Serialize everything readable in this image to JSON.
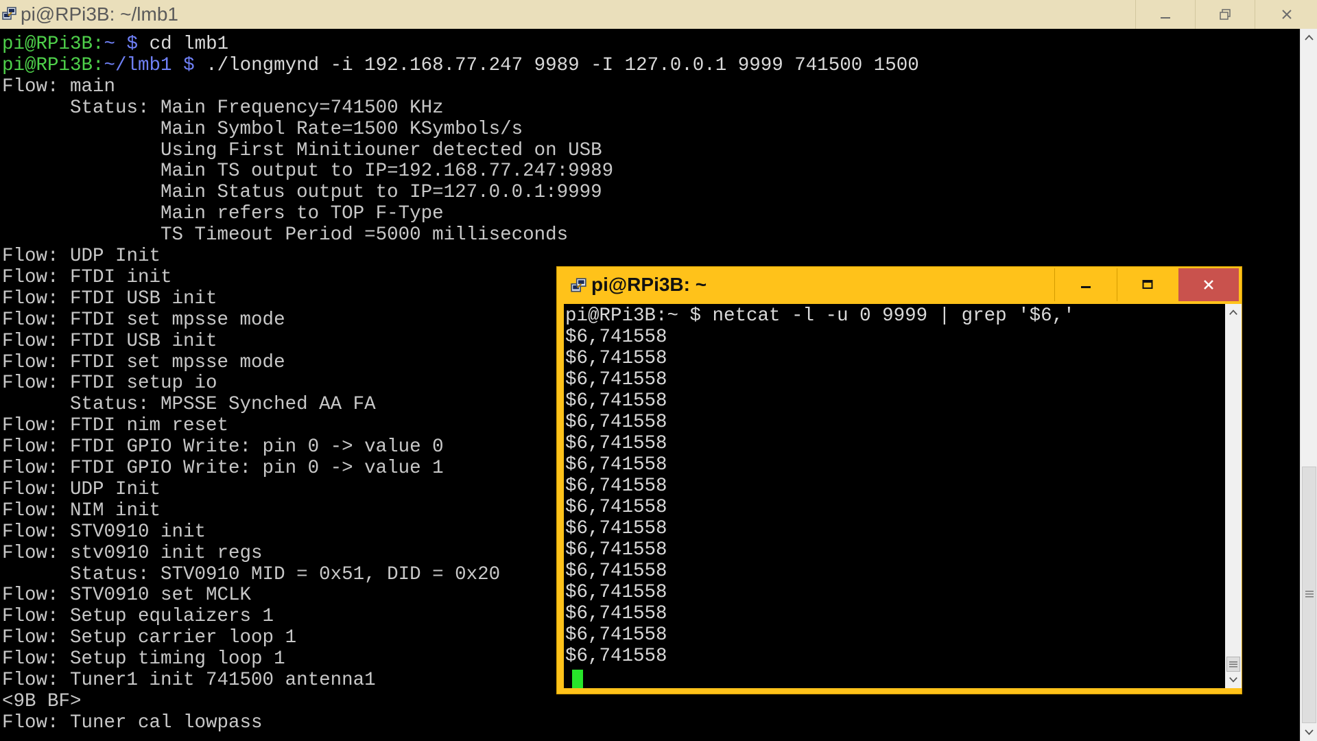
{
  "main_window": {
    "title": "pi@RPi3B: ~/lmb1",
    "lines": [
      [
        {
          "t": "pi@RPi3B:",
          "c": "green"
        },
        {
          "t": "~ ",
          "c": "blue"
        },
        {
          "t": "$ ",
          "c": "blue"
        },
        {
          "t": "cd lmb1",
          "c": "white"
        }
      ],
      [
        {
          "t": "pi@RPi3B:",
          "c": "green"
        },
        {
          "t": "~/lmb1 ",
          "c": "blue"
        },
        {
          "t": "$ ",
          "c": "blue"
        },
        {
          "t": "./longmynd -i 192.168.77.247 9989 -I 127.0.0.1 9999 741500 1500",
          "c": "white"
        }
      ],
      [
        {
          "t": "Flow: main",
          "c": "plain"
        }
      ],
      [
        {
          "t": "      Status: Main Frequency=741500 KHz",
          "c": "plain"
        }
      ],
      [
        {
          "t": "              Main Symbol Rate=1500 KSymbols/s",
          "c": "plain"
        }
      ],
      [
        {
          "t": "              Using First Minitiouner detected on USB",
          "c": "plain"
        }
      ],
      [
        {
          "t": "              Main TS output to IP=192.168.77.247:9989",
          "c": "plain"
        }
      ],
      [
        {
          "t": "              Main Status output to IP=127.0.0.1:9999",
          "c": "plain"
        }
      ],
      [
        {
          "t": "              Main refers to TOP F-Type",
          "c": "plain"
        }
      ],
      [
        {
          "t": "              TS Timeout Period =5000 milliseconds",
          "c": "plain"
        }
      ],
      [
        {
          "t": "Flow: UDP Init",
          "c": "plain"
        }
      ],
      [
        {
          "t": "Flow: FTDI init",
          "c": "plain"
        }
      ],
      [
        {
          "t": "Flow: FTDI USB init",
          "c": "plain"
        }
      ],
      [
        {
          "t": "Flow: FTDI set mpsse mode",
          "c": "plain"
        }
      ],
      [
        {
          "t": "Flow: FTDI USB init",
          "c": "plain"
        }
      ],
      [
        {
          "t": "Flow: FTDI set mpsse mode",
          "c": "plain"
        }
      ],
      [
        {
          "t": "Flow: FTDI setup io",
          "c": "plain"
        }
      ],
      [
        {
          "t": "      Status: MPSSE Synched AA FA",
          "c": "plain"
        }
      ],
      [
        {
          "t": "Flow: FTDI nim reset",
          "c": "plain"
        }
      ],
      [
        {
          "t": "Flow: FTDI GPIO Write: pin 0 -> value 0",
          "c": "plain"
        }
      ],
      [
        {
          "t": "Flow: FTDI GPIO Write: pin 0 -> value 1",
          "c": "plain"
        }
      ],
      [
        {
          "t": "Flow: UDP Init",
          "c": "plain"
        }
      ],
      [
        {
          "t": "Flow: NIM init",
          "c": "plain"
        }
      ],
      [
        {
          "t": "Flow: STV0910 init",
          "c": "plain"
        }
      ],
      [
        {
          "t": "Flow: stv0910 init regs",
          "c": "plain"
        }
      ],
      [
        {
          "t": "      Status: STV0910 MID = 0x51, DID = 0x20",
          "c": "plain"
        }
      ],
      [
        {
          "t": "Flow: STV0910 set MCLK",
          "c": "plain"
        }
      ],
      [
        {
          "t": "Flow: Setup equlaizers 1",
          "c": "plain"
        }
      ],
      [
        {
          "t": "Flow: Setup carrier loop 1",
          "c": "plain"
        }
      ],
      [
        {
          "t": "Flow: Setup timing loop 1",
          "c": "plain"
        }
      ],
      [
        {
          "t": "Flow: Tuner1 init 741500 antenna1",
          "c": "plain"
        }
      ],
      [
        {
          "t": "<9B BF>",
          "c": "plain"
        }
      ],
      [
        {
          "t": "Flow: Tuner cal lowpass",
          "c": "plain"
        }
      ]
    ]
  },
  "popup_window": {
    "title": "pi@RPi3B: ~",
    "lines": [
      [
        {
          "t": "pi@RPi3B:~ $ netcat -l -u 0 9999 | grep '$6,'",
          "c": "white"
        }
      ],
      [
        {
          "t": "$6,741558",
          "c": "white"
        }
      ],
      [
        {
          "t": "$6,741558",
          "c": "white"
        }
      ],
      [
        {
          "t": "$6,741558",
          "c": "white"
        }
      ],
      [
        {
          "t": "$6,741558",
          "c": "white"
        }
      ],
      [
        {
          "t": "$6,741558",
          "c": "white"
        }
      ],
      [
        {
          "t": "$6,741558",
          "c": "white"
        }
      ],
      [
        {
          "t": "$6,741558",
          "c": "white"
        }
      ],
      [
        {
          "t": "$6,741558",
          "c": "white"
        }
      ],
      [
        {
          "t": "$6,741558",
          "c": "white"
        }
      ],
      [
        {
          "t": "$6,741558",
          "c": "white"
        }
      ],
      [
        {
          "t": "$6,741558",
          "c": "white"
        }
      ],
      [
        {
          "t": "$6,741558",
          "c": "white"
        }
      ],
      [
        {
          "t": "$6,741558",
          "c": "white"
        }
      ],
      [
        {
          "t": "$6,741558",
          "c": "white"
        }
      ],
      [
        {
          "t": "$6,741558",
          "c": "white"
        }
      ],
      [
        {
          "t": "$6,741558",
          "c": "white"
        }
      ]
    ]
  },
  "icons": {
    "app": "putty-icon",
    "minimize": "minimize-icon",
    "maximize": "maximize-icon",
    "restore": "restore-icon",
    "close": "close-icon"
  },
  "colors": {
    "terminal_bg": "#000000",
    "prompt_user": "#4ed04a",
    "prompt_path": "#6f80f6",
    "output_text": "#c8c8c8",
    "main_titlebar": "#eadfbb",
    "popup_frame": "#ffc21a",
    "popup_close": "#c9524d",
    "cursor": "#27e52a"
  }
}
